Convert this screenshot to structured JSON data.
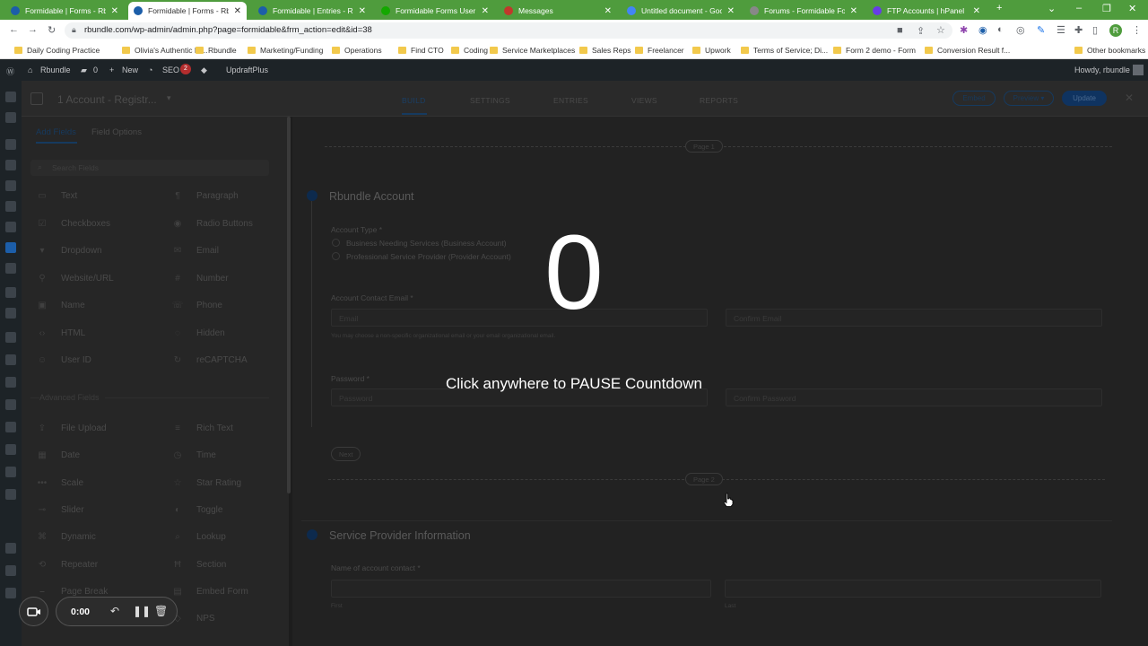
{
  "tabs": [
    {
      "title": "Formidable | Forms - Rbun",
      "fav": "#1c5ea9",
      "active": false
    },
    {
      "title": "Formidable | Forms - Rbun",
      "fav": "#1c5ea9",
      "active": true
    },
    {
      "title": "Formidable | Entries - Rbu",
      "fav": "#1c5ea9",
      "active": false
    },
    {
      "title": "Formidable Forms User Re",
      "fav": "#14a800",
      "active": false
    },
    {
      "title": "Messages",
      "fav": "#c0392b",
      "active": false
    },
    {
      "title": "Untitled document - Goog",
      "fav": "#4285f4",
      "active": false
    },
    {
      "title": "Forums - Formidable Form",
      "fav": "#888888",
      "active": false
    },
    {
      "title": "FTP Accounts | hPanel",
      "fav": "#673de6",
      "active": false
    }
  ],
  "address": {
    "url": "rbundle.com/wp-admin/admin.php?page=formidable&frm_action=edit&id=38"
  },
  "bookmarks": [
    "Daily Coding Practice",
    "Olivia's Authentic Ki...",
    "Rbundle",
    "Marketing/Funding",
    "Operations",
    "Find CTO",
    "Coding",
    "Service Marketplaces",
    "Sales Reps",
    "Freelancer",
    "Upwork",
    "Terms of Service; Di...",
    "Form 2 demo - Form",
    "Conversion Result f...",
    "Other bookmarks"
  ],
  "adminbar": {
    "site": "Rbundle",
    "comments": "0",
    "new": "New",
    "seo": "SEO",
    "seo_count": "2",
    "plugin": "UpdraftPlus",
    "howdy": "Howdy, rbundle"
  },
  "formheader": {
    "form_title": "1 Account - Registr...",
    "tabs": [
      "BUILD",
      "SETTINGS",
      "ENTRIES",
      "VIEWS",
      "REPORTS"
    ],
    "embed": "Embed",
    "preview": "Preview",
    "update": "Update"
  },
  "fieldpanel": {
    "tab_add": "Add Fields",
    "tab_options": "Field Options",
    "search_placeholder": "Search Fields",
    "basic_fields": [
      {
        "left": "Text",
        "left_icon": "text-icon",
        "right": "Paragraph",
        "right_icon": "paragraph-icon"
      },
      {
        "left": "Checkboxes",
        "left_icon": "checkbox-icon",
        "right": "Radio Buttons",
        "right_icon": "radio-icon"
      },
      {
        "left": "Dropdown",
        "left_icon": "dropdown-icon",
        "right": "Email",
        "right_icon": "email-icon"
      },
      {
        "left": "Website/URL",
        "left_icon": "link-icon",
        "right": "Number",
        "right_icon": "hash-icon"
      },
      {
        "left": "Name",
        "left_icon": "name-icon",
        "right": "Phone",
        "right_icon": "phone-icon"
      },
      {
        "left": "HTML",
        "left_icon": "code-icon",
        "right": "Hidden",
        "right_icon": "hidden-icon"
      },
      {
        "left": "User ID",
        "left_icon": "user-icon",
        "right": "reCAPTCHA",
        "right_icon": "recaptcha-icon"
      }
    ],
    "advanced_label": "Advanced Fields",
    "advanced_fields": [
      {
        "left": "File Upload",
        "left_icon": "upload-icon",
        "right": "Rich Text",
        "right_icon": "richtext-icon"
      },
      {
        "left": "Date",
        "left_icon": "calendar-icon",
        "right": "Time",
        "right_icon": "clock-icon"
      },
      {
        "left": "Scale",
        "left_icon": "scale-icon",
        "right": "Star Rating",
        "right_icon": "star-icon"
      },
      {
        "left": "Slider",
        "left_icon": "slider-icon",
        "right": "Toggle",
        "right_icon": "toggle-icon"
      },
      {
        "left": "Dynamic",
        "left_icon": "dynamic-icon",
        "right": "Lookup",
        "right_icon": "search-icon"
      },
      {
        "left": "Repeater",
        "left_icon": "repeater-icon",
        "right": "Section",
        "right_icon": "section-icon"
      },
      {
        "left": "Page Break",
        "left_icon": "pagebreak-icon",
        "right": "Embed Form",
        "right_icon": "embed-icon"
      },
      {
        "left": "",
        "left_icon": "",
        "right": "NPS",
        "right_icon": "nps-icon"
      }
    ]
  },
  "canvas": {
    "page1_label": "Page 1",
    "section1_title": "Rbundle Account",
    "account_type_label": "Account Type *",
    "account_type_options": [
      "Business Needing Services (Business Account)",
      "Professional Service Provider (Provider Account)"
    ],
    "email_label": "Account Contact Email *",
    "email_placeholder": "Email",
    "confirm_email_placeholder": "Confirm Email",
    "email_help": "You may choose a non-specific organizational email or your email organizational email.",
    "password_label": "Password *",
    "password_placeholder": "Password",
    "confirm_password_placeholder": "Confirm Password",
    "next_button": "Next",
    "page2_label": "Page 2",
    "section2_title": "Service Provider Information",
    "contact_name_label": "Name of account contact *",
    "first_sub": "First",
    "last_sub": "Last"
  },
  "overlay": {
    "countdown": "0",
    "message": "Click anywhere to PAUSE Countdown"
  },
  "recorder": {
    "time": "0:00"
  }
}
